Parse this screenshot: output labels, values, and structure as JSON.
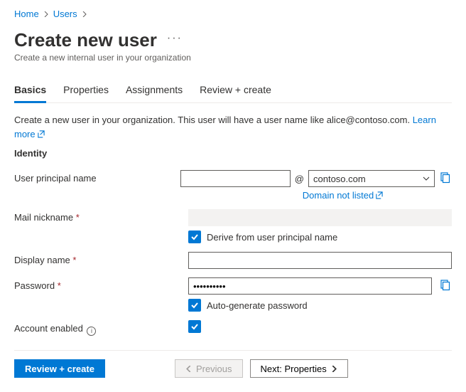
{
  "breadcrumb": {
    "home": "Home",
    "users": "Users"
  },
  "header": {
    "title": "Create new user",
    "subtitle": "Create a new internal user in your organization"
  },
  "tabs": {
    "basics": "Basics",
    "properties": "Properties",
    "assignments": "Assignments",
    "review": "Review + create"
  },
  "intro": {
    "text": "Create a new user in your organization. This user will have a user name like alice@contoso.com.",
    "learn_more": "Learn more"
  },
  "section": {
    "identity": "Identity"
  },
  "labels": {
    "upn": "User principal name",
    "mail_nick": "Mail nickname",
    "display_name": "Display name",
    "password": "Password",
    "account_enabled": "Account enabled"
  },
  "fields": {
    "upn_value": "",
    "domain_selected": "contoso.com",
    "domain_not_listed": "Domain not listed",
    "mail_nick_value": "",
    "derive_label": "Derive from user principal name",
    "display_name_value": "",
    "password_value": "••••••••••",
    "auto_gen_label": "Auto-generate password"
  },
  "footer": {
    "review_create": "Review + create",
    "previous": "Previous",
    "next": "Next: Properties"
  }
}
